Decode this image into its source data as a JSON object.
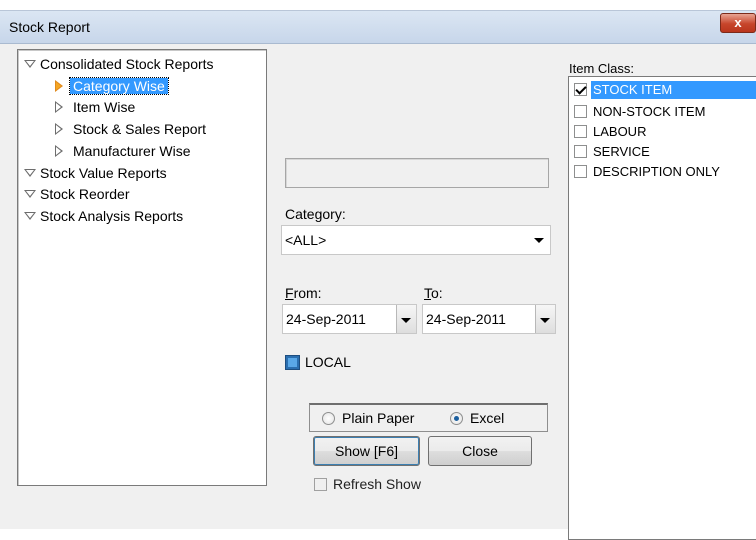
{
  "window": {
    "title": "Stock Report",
    "close_icon": "close-x-icon",
    "close_label": "x"
  },
  "tree": {
    "items": [
      {
        "label": "Consolidated Stock Reports",
        "expanded": true,
        "level": 0
      },
      {
        "label": "Category Wise",
        "level": 1,
        "selected": true
      },
      {
        "label": "Item Wise",
        "level": 1
      },
      {
        "label": "Stock & Sales Report",
        "level": 1
      },
      {
        "label": "Manufacturer Wise",
        "level": 1
      },
      {
        "label": "Stock Value Reports",
        "expanded": true,
        "level": 0
      },
      {
        "label": "Stock Reorder",
        "expanded": true,
        "level": 0
      },
      {
        "label": "Stock Analysis Reports",
        "expanded": true,
        "level": 0
      }
    ]
  },
  "form": {
    "text_value": "",
    "category_label_pre": "Cate",
    "category_label_ul": "g",
    "category_label_post": "ory:",
    "category_value": "<ALL>",
    "from_label_ul": "F",
    "from_label_post": "rom:",
    "to_label_ul": "T",
    "to_label_post": "o:",
    "from_date": "24-Sep-2011",
    "to_date": "24-Sep-2011",
    "local_label": "LOCAL",
    "output_options": [
      "Plain Paper",
      "Excel"
    ],
    "output_selected": "Excel",
    "show_button": "Show [F6]",
    "close_button": "Close",
    "refresh_label": "Refresh  Show",
    "refresh_checked": false
  },
  "item_class": {
    "label": "Item Class:",
    "items": [
      {
        "label": "STOCK ITEM",
        "checked": true,
        "selected": true
      },
      {
        "label": "NON-STOCK ITEM",
        "checked": false
      },
      {
        "label": "LABOUR",
        "checked": false
      },
      {
        "label": "SERVICE",
        "checked": false
      },
      {
        "label": "DESCRIPTION ONLY",
        "checked": false
      }
    ]
  },
  "colors": {
    "selection": "#3399ff",
    "title_bar": "#c7d6ea",
    "close_button": "#c7452b",
    "active_arrow": "#f5a623"
  }
}
